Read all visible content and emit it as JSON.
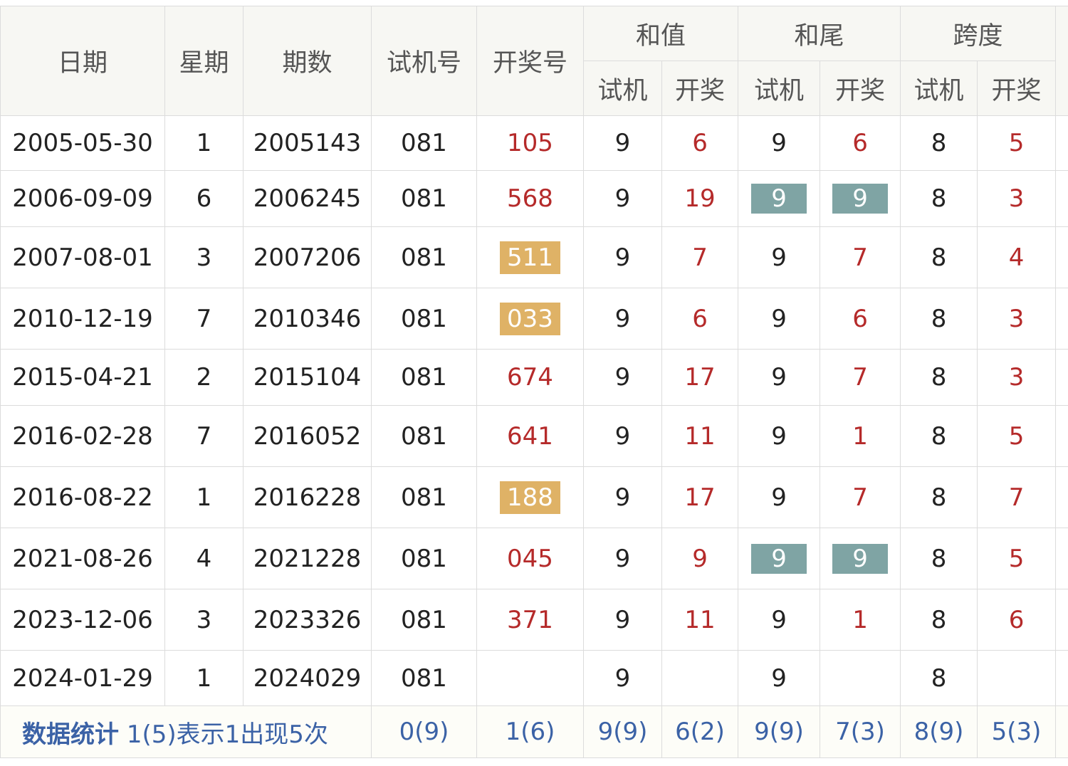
{
  "headers": {
    "date": "日期",
    "weekday": "星期",
    "issue": "期数",
    "test_number": "试机号",
    "draw_number": "开奖号",
    "sum": "和值",
    "sum_tail": "和尾",
    "span": "跨度",
    "sub_test": "试机",
    "sub_draw": "开奖"
  },
  "rows": [
    {
      "date": "2005-05-30",
      "weekday": "1",
      "issue": "2005143",
      "test": "081",
      "draw": "105",
      "sum_test": "9",
      "sum_draw": "6",
      "tail_test": "9",
      "tail_draw": "6",
      "span_test": "8",
      "span_draw": "5"
    },
    {
      "date": "2006-09-09",
      "weekday": "6",
      "issue": "2006245",
      "test": "081",
      "draw": "568",
      "sum_test": "9",
      "sum_draw": "19",
      "tail_test": "9",
      "tail_draw": "9",
      "span_test": "8",
      "span_draw": "3"
    },
    {
      "date": "2007-08-01",
      "weekday": "3",
      "issue": "2007206",
      "test": "081",
      "draw": "511",
      "sum_test": "9",
      "sum_draw": "7",
      "tail_test": "9",
      "tail_draw": "7",
      "span_test": "8",
      "span_draw": "4"
    },
    {
      "date": "2010-12-19",
      "weekday": "7",
      "issue": "2010346",
      "test": "081",
      "draw": "033",
      "sum_test": "9",
      "sum_draw": "6",
      "tail_test": "9",
      "tail_draw": "6",
      "span_test": "8",
      "span_draw": "3"
    },
    {
      "date": "2015-04-21",
      "weekday": "2",
      "issue": "2015104",
      "test": "081",
      "draw": "674",
      "sum_test": "9",
      "sum_draw": "17",
      "tail_test": "9",
      "tail_draw": "7",
      "span_test": "8",
      "span_draw": "3"
    },
    {
      "date": "2016-02-28",
      "weekday": "7",
      "issue": "2016052",
      "test": "081",
      "draw": "641",
      "sum_test": "9",
      "sum_draw": "11",
      "tail_test": "9",
      "tail_draw": "1",
      "span_test": "8",
      "span_draw": "5"
    },
    {
      "date": "2016-08-22",
      "weekday": "1",
      "issue": "2016228",
      "test": "081",
      "draw": "188",
      "sum_test": "9",
      "sum_draw": "17",
      "tail_test": "9",
      "tail_draw": "7",
      "span_test": "8",
      "span_draw": "7"
    },
    {
      "date": "2021-08-26",
      "weekday": "4",
      "issue": "2021228",
      "test": "081",
      "draw": "045",
      "sum_test": "9",
      "sum_draw": "9",
      "tail_test": "9",
      "tail_draw": "9",
      "span_test": "8",
      "span_draw": "5"
    },
    {
      "date": "2023-12-06",
      "weekday": "3",
      "issue": "2023326",
      "test": "081",
      "draw": "371",
      "sum_test": "9",
      "sum_draw": "11",
      "tail_test": "9",
      "tail_draw": "1",
      "span_test": "8",
      "span_draw": "6"
    },
    {
      "date": "2024-01-29",
      "weekday": "1",
      "issue": "2024029",
      "test": "081",
      "draw": "",
      "sum_test": "9",
      "sum_draw": "",
      "tail_test": "9",
      "tail_draw": "",
      "span_test": "8",
      "span_draw": ""
    }
  ],
  "stats": {
    "title": "数据统计",
    "desc": "1(5)表示1出现5次",
    "test": "0(9)",
    "draw": "1(6)",
    "sum_test": "9(9)",
    "sum_draw": "6(2)",
    "tail_test": "9(9)",
    "tail_draw": "7(3)",
    "span_test": "8(9)",
    "span_draw": "5(3)"
  },
  "colors": {
    "draw_red": "#b52a2a",
    "highlight_orange": "#dfb266",
    "highlight_teal": "#7fa4a4",
    "stat_blue": "#3b62a6"
  }
}
